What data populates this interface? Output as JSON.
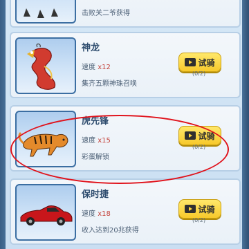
{
  "cards": [
    {
      "name": "",
      "speed_label": "",
      "speed_mult": "",
      "unlock": "击败关二爷获得",
      "button_label": "",
      "button_count": ""
    },
    {
      "name": "神龙",
      "speed_label": "速度",
      "speed_mult": "x12",
      "unlock": "集齐五颗神珠召唤",
      "button_label": "试骑",
      "button_count": "(0/2)"
    },
    {
      "name": "虎先锋",
      "speed_label": "速度",
      "speed_mult": "x15",
      "unlock": "彩蛋解锁",
      "button_label": "试骑",
      "button_count": "(0/2)"
    },
    {
      "name": "保时捷",
      "speed_label": "速度",
      "speed_mult": "x18",
      "unlock": "收入达到20兆获得",
      "button_label": "试骑",
      "button_count": "(0/2)"
    }
  ],
  "colors": {
    "accent_red": "#c4423b",
    "button_yellow": "#f7c92b",
    "highlight_ring": "#e0121b"
  },
  "icons": [
    "play-icon",
    "dragon-image",
    "tiger-image",
    "car-image",
    "horse-image"
  ]
}
